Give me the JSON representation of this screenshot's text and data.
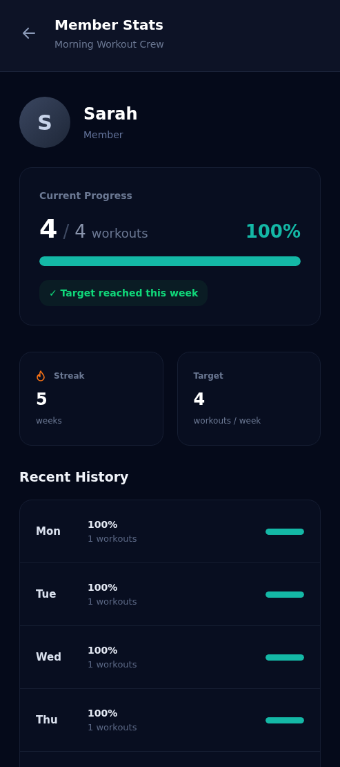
{
  "header": {
    "title": "Member Stats",
    "subtitle": "Morning Workout Crew"
  },
  "member": {
    "initial": "S",
    "name": "Sarah",
    "role": "Member"
  },
  "progress": {
    "label": "Current Progress",
    "done": "4",
    "separator": "/",
    "target": "4",
    "unit": "workouts",
    "percent": "100%",
    "level": 1,
    "badge": "✓ Target reached this week",
    "reached": true
  },
  "stats": [
    {
      "kind": "streak",
      "label": "Streak",
      "value": "5",
      "unit": "weeks"
    },
    {
      "kind": "target",
      "label": "Target",
      "value": "4",
      "unit": "workouts / week"
    }
  ],
  "history": {
    "title": "Recent History",
    "rows": [
      {
        "day": "Mon",
        "percent": "100%",
        "count": "1 workouts",
        "level": 1
      },
      {
        "day": "Tue",
        "percent": "100%",
        "count": "1 workouts",
        "level": 1
      },
      {
        "day": "Wed",
        "percent": "100%",
        "count": "1 workouts",
        "level": 1
      },
      {
        "day": "Thu",
        "percent": "100%",
        "count": "1 workouts",
        "level": 1
      }
    ]
  }
}
